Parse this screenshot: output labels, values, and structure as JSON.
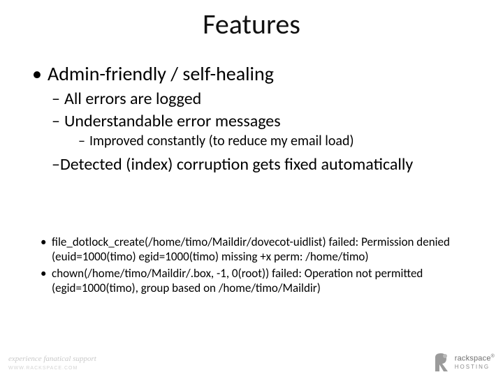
{
  "title": "Features",
  "bullets": {
    "l1": "Admin-friendly / self-healing",
    "l2a": "All errors are logged",
    "l2b": "Understandable error messages",
    "l3": "Improved constantly (to reduce my email load)",
    "l2c": "Detected (index) corruption gets fixed automatically"
  },
  "errors": {
    "e1": "file_dotlock_create(/home/timo/Maildir/dovecot-uidlist) failed: Permission denied (euid=1000(timo) egid=1000(timo) missing +x perm: /home/timo)",
    "e2": "chown(/home/timo/Maildir/.box, -1, 0(root)) failed: Operation not permitted (egid=1000(timo), group based on /home/timo/Maildir)"
  },
  "footer": {
    "tagline": "experience fanatical support",
    "tagline_url": "WWW.RACKSPACE.COM",
    "brand_top": "rackspace",
    "brand_bottom": "HOSTING"
  }
}
